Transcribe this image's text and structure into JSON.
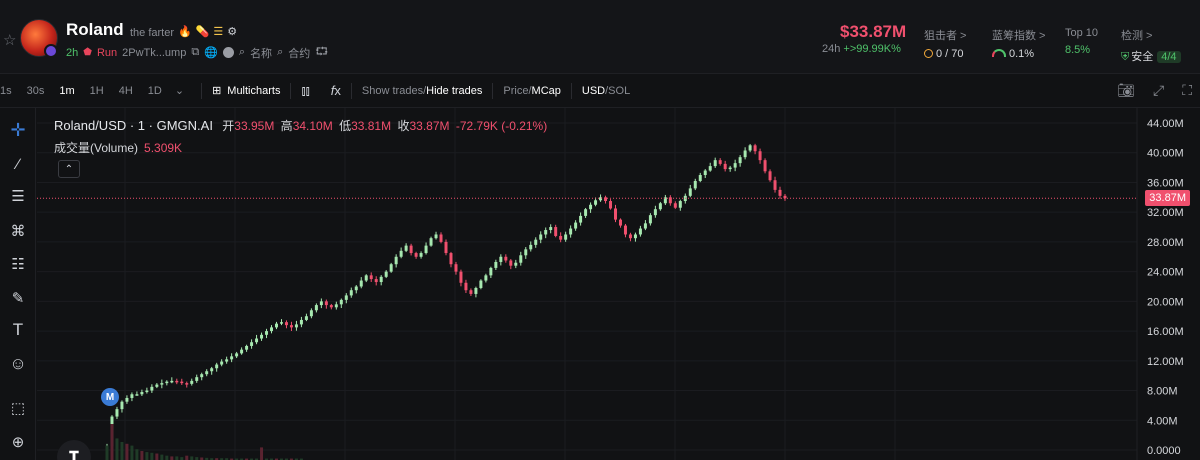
{
  "header": {
    "token_name": "Roland",
    "token_subtitle": "the farter",
    "age": "2h",
    "run_label": "Run",
    "address": "2PwTk...ump",
    "name_label": "名称",
    "contract_label": "合约",
    "market_cap": "$33.87M",
    "change_period": "24h",
    "change_value": "+>99.99K%",
    "stats": [
      {
        "label": "狙击者 >",
        "value": "0 / 70"
      },
      {
        "label": "蓝筹指数 >",
        "value": "0.1%"
      },
      {
        "label": "Top 10",
        "value": "8.5%"
      },
      {
        "label": "检测 >",
        "value": "安全",
        "badge": "4/4"
      }
    ]
  },
  "toolbar": {
    "timeframes": [
      "1s",
      "30s",
      "1m",
      "1H",
      "4H",
      "1D"
    ],
    "active_timeframe": "1m",
    "multicharts_label": "Multicharts",
    "show_trades": "Show trades",
    "hide_trades": "Hide trades",
    "price_label": "Price",
    "mcap_label": "MCap",
    "usd_label": "USD",
    "sol_label": "SOL"
  },
  "legend": {
    "symbol": "Roland/USD · 1 · GMGN.AI",
    "open_label": "开",
    "open": "33.95M",
    "high_label": "高",
    "high": "34.10M",
    "low_label": "低",
    "low": "33.81M",
    "close_label": "收",
    "close": "33.87M",
    "change": "-72.79K (-0.21%)",
    "volume_label": "成交量(Volume)",
    "volume": "5.309K"
  },
  "chart_data": {
    "type": "candlestick",
    "y_unit": "market cap (USD, millions)",
    "ylim": [
      0,
      44
    ],
    "yticks": [
      "44.00M",
      "40.00M",
      "36.00M",
      "32.00M",
      "28.00M",
      "24.00M",
      "20.00M",
      "16.00M",
      "12.00M",
      "8.00M",
      "4.00M",
      "0.0000"
    ],
    "current_price_label": "33.87M",
    "current_price": 33.87,
    "marker_label": "M",
    "close_path": [
      0.5,
      4.5,
      5.5,
      6.5,
      7.0,
      7.5,
      7.5,
      7.8,
      8.0,
      8.5,
      8.8,
      9.0,
      9.2,
      9.3,
      9.2,
      9.0,
      8.9,
      9.3,
      9.8,
      10.2,
      10.6,
      11.0,
      11.5,
      11.9,
      12.2,
      12.6,
      13.0,
      13.5,
      14.0,
      14.5,
      15.0,
      15.5,
      16.0,
      16.5,
      17.0,
      17.2,
      16.8,
      16.5,
      16.9,
      17.5,
      18.0,
      18.8,
      19.5,
      20.0,
      19.5,
      19.2,
      19.6,
      20.2,
      20.8,
      21.5,
      22.0,
      22.8,
      23.5,
      23.0,
      22.6,
      23.3,
      24.0,
      25.0,
      26.0,
      26.8,
      27.5,
      26.5,
      26.0,
      26.5,
      27.5,
      28.5,
      29.0,
      28.0,
      26.5,
      25.0,
      24.0,
      22.5,
      21.5,
      21.0,
      21.8,
      22.8,
      23.5,
      24.5,
      25.3,
      26.0,
      25.5,
      24.8,
      25.2,
      26.2,
      27.0,
      27.6,
      28.3,
      29.0,
      29.6,
      30.0,
      28.8,
      28.3,
      29.0,
      29.8,
      30.6,
      31.5,
      32.4,
      33.0,
      33.6,
      34.0,
      33.5,
      32.5,
      31.0,
      30.2,
      29.0,
      28.5,
      29.0,
      29.8,
      30.5,
      31.6,
      32.4,
      33.2,
      34.0,
      33.2,
      32.6,
      33.5,
      34.2,
      35.2,
      36.2,
      37.0,
      37.6,
      38.2,
      39.0,
      38.5,
      37.8,
      38.0,
      38.6,
      39.4,
      40.3,
      41.0,
      40.2,
      39.0,
      37.5,
      36.3,
      35.0,
      34.2,
      33.87
    ],
    "volume_path": [
      0.4,
      1.0,
      0.6,
      0.5,
      0.45,
      0.4,
      0.3,
      0.25,
      0.22,
      0.2,
      0.18,
      0.15,
      0.12,
      0.1,
      0.1,
      0.08,
      0.12,
      0.1,
      0.08,
      0.07,
      0.06,
      0.05,
      0.05,
      0.05,
      0.05,
      0.04,
      0.04,
      0.04,
      0.04,
      0.04,
      0.04,
      0.35,
      0.04,
      0.04,
      0.04,
      0.04,
      0.04,
      0.04,
      0.04,
      0.04
    ],
    "colors": {
      "up": "#a7e8b0",
      "down": "#f0506e",
      "price_line": "#f0506e",
      "grid": "#1b1c20"
    }
  }
}
